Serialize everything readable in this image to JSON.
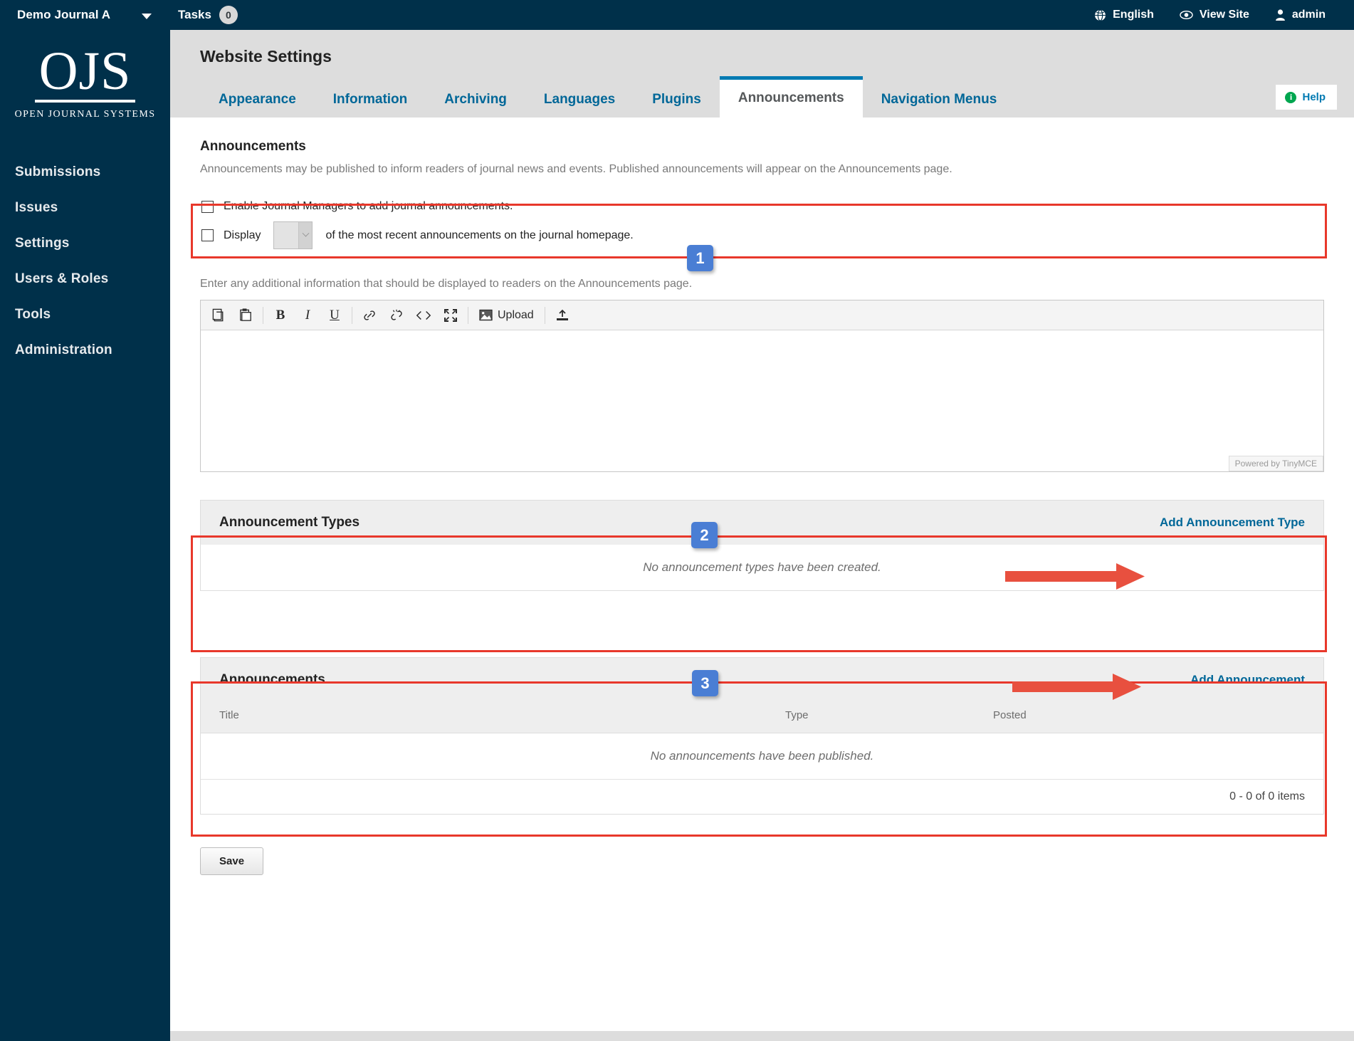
{
  "topbar": {
    "journal_name": "Demo Journal A",
    "journal_caret": "chevron-down-icon",
    "tasks_label": "Tasks",
    "tasks_count": "0",
    "language": "English",
    "view_site": "View Site",
    "user": "admin"
  },
  "sidebar": {
    "logo_letters": "OJS",
    "logo_subtitle": "OPEN JOURNAL SYSTEMS",
    "items": [
      {
        "label": "Submissions"
      },
      {
        "label": "Issues"
      },
      {
        "label": "Settings"
      },
      {
        "label": "Users & Roles"
      },
      {
        "label": "Tools"
      },
      {
        "label": "Administration"
      }
    ]
  },
  "header": {
    "title": "Website Settings",
    "help_label": "Help"
  },
  "tabs": [
    {
      "label": "Appearance",
      "active": false
    },
    {
      "label": "Information",
      "active": false
    },
    {
      "label": "Archiving",
      "active": false
    },
    {
      "label": "Languages",
      "active": false
    },
    {
      "label": "Plugins",
      "active": false
    },
    {
      "label": "Announcements",
      "active": true
    },
    {
      "label": "Navigation Menus",
      "active": false
    }
  ],
  "announcements_section": {
    "title": "Announcements",
    "description": "Announcements may be published to inform readers of journal news and events. Published announcements will appear on the Announcements page.",
    "enable_checkbox_label": "Enable Journal Managers to add journal announcements.",
    "display_prefix": "Display",
    "display_select_value": "",
    "display_suffix": "of the most recent announcements on the journal homepage.",
    "editor_helper": "Enter any additional information that should be displayed to readers on the Announcements page."
  },
  "editor": {
    "toolbar": [
      {
        "name": "copy-icon",
        "label": ""
      },
      {
        "name": "paste-icon",
        "label": ""
      },
      {
        "name": "bold-icon",
        "label": "B"
      },
      {
        "name": "italic-icon",
        "label": "I"
      },
      {
        "name": "underline-icon",
        "label": "U"
      },
      {
        "name": "link-icon",
        "label": ""
      },
      {
        "name": "unlink-icon",
        "label": ""
      },
      {
        "name": "source-code-icon",
        "label": ""
      },
      {
        "name": "fullscreen-icon",
        "label": ""
      },
      {
        "name": "image-upload-icon",
        "label": "Upload"
      },
      {
        "name": "add-file-icon",
        "label": ""
      }
    ],
    "upload_label": "Upload",
    "status_text": "Powered by TinyMCE",
    "content": ""
  },
  "announcement_types_panel": {
    "title": "Announcement Types",
    "action_label": "Add Announcement Type",
    "empty_message": "No announcement types have been created."
  },
  "announcements_panel": {
    "title": "Announcements",
    "action_label": "Add Announcement",
    "columns": [
      "Title",
      "Type",
      "Posted"
    ],
    "empty_message": "No announcements have been published.",
    "pagination": "0 - 0 of 0 items"
  },
  "save_button_label": "Save",
  "annotations": {
    "markers": [
      "1",
      "2",
      "3"
    ],
    "colors": {
      "box": "#e8382b",
      "badge": "#4a7ed4",
      "arrow": "#e8503f"
    }
  }
}
